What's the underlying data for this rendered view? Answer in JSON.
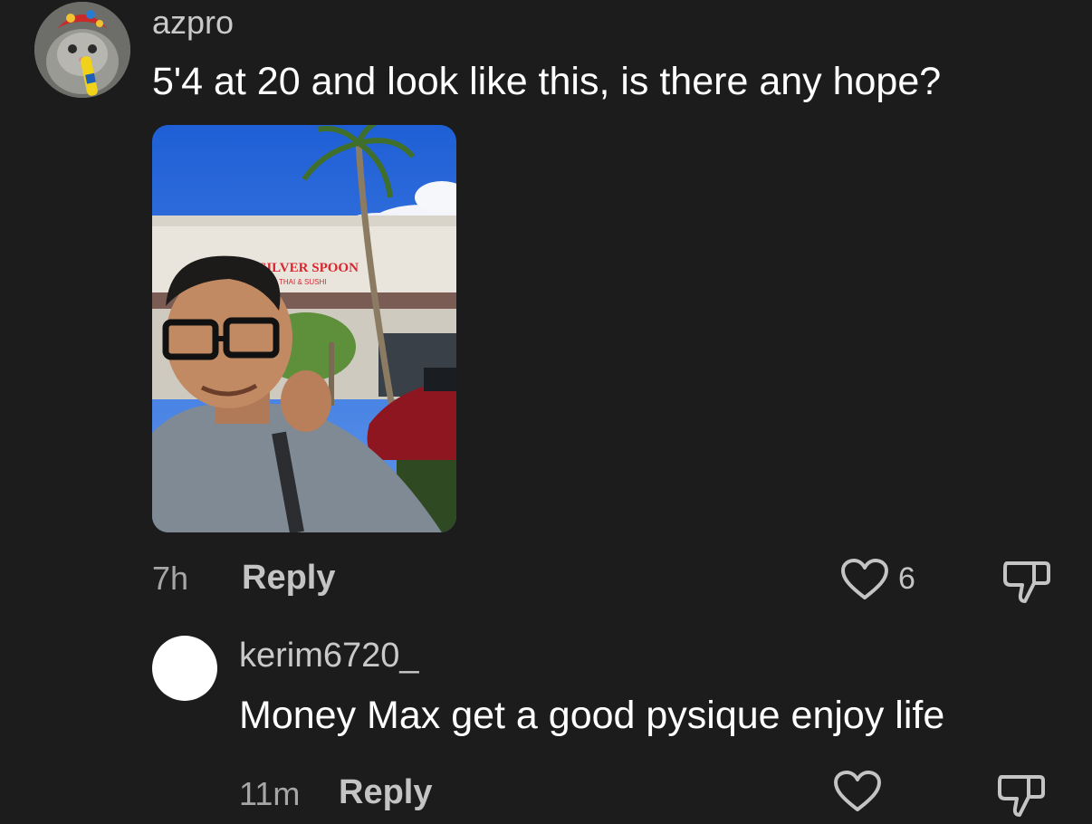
{
  "comments": [
    {
      "username": "azpro",
      "text": "5'4 at 20 and look like this, is there any hope?",
      "time": "7h",
      "reply_label": "Reply",
      "like_count": "6",
      "has_image": true,
      "image": {
        "sign_text": "SILVER SPOON",
        "sign_subtext": "THAI & SUSHI"
      }
    },
    {
      "username": "kerim6720_",
      "text": "Money Max get a good pysique enjoy life",
      "time": "11m",
      "reply_label": "Reply",
      "like_count": "",
      "has_image": false
    }
  ],
  "icons": {
    "like": "heart-outline-icon",
    "dislike": "thumbs-down-outline-icon"
  },
  "colors": {
    "background": "#1c1c1c",
    "username": "#c9c9c9",
    "text": "#ffffff",
    "meta": "#a6a6a6",
    "accent_sign": "#d8262f"
  }
}
